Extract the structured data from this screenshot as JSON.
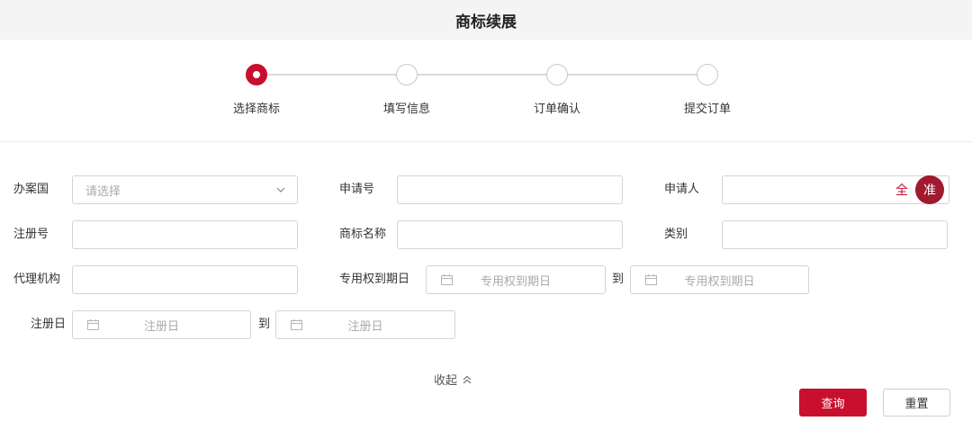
{
  "header": {
    "title": "商标续展"
  },
  "steps": [
    {
      "label": "选择商标",
      "active": true
    },
    {
      "label": "填写信息",
      "active": false
    },
    {
      "label": "订单确认",
      "active": false
    },
    {
      "label": "提交订单",
      "active": false
    }
  ],
  "form": {
    "office": {
      "label": "办案国",
      "placeholder": "请选择"
    },
    "application_no": {
      "label": "申请号",
      "value": ""
    },
    "applicant": {
      "label": "申请人",
      "value": "",
      "btn_all": "全",
      "btn_exact": "准"
    },
    "registration_no": {
      "label": "注册号",
      "value": ""
    },
    "trademark_name": {
      "label": "商标名称",
      "value": ""
    },
    "category": {
      "label": "类别",
      "value": ""
    },
    "agency": {
      "label": "代理机构",
      "value": ""
    },
    "expiry_date": {
      "label": "专用权到期日",
      "start_placeholder": "专用权到期日",
      "to": "到",
      "end_placeholder": "专用权到期日"
    },
    "registration_date": {
      "label": "注册日",
      "start_placeholder": "注册日",
      "to": "到",
      "end_placeholder": "注册日"
    }
  },
  "collapse_label": "收起",
  "actions": {
    "query": "查询",
    "reset": "重置"
  }
}
